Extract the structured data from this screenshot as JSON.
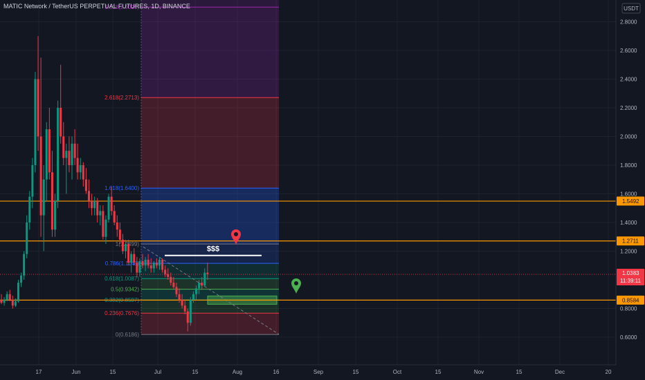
{
  "header": {
    "title": "MATIC Network / TetherUS PERPETUAL FUTURES, 1D, BINANCE",
    "currency_button": "USDT"
  },
  "price_axis": {
    "ticks": [
      "2.8000",
      "2.6000",
      "2.4000",
      "2.2000",
      "2.0000",
      "1.8000",
      "1.6000",
      "1.4000",
      "1.2000",
      "0.8000",
      "0.6000"
    ],
    "tick_values": [
      2.8,
      2.6,
      2.4,
      2.2,
      2.0,
      1.8,
      1.6,
      1.4,
      1.2,
      0.8,
      0.6
    ],
    "current_price": "1.0383",
    "countdown": "11:39:11",
    "level_labels": [
      {
        "text": "1.5492",
        "value": 1.5492
      },
      {
        "text": "1.2711",
        "value": 1.2711
      },
      {
        "text": "0.8584",
        "value": 0.8584
      }
    ]
  },
  "time_axis": {
    "labels": [
      "17",
      "Jun",
      "15",
      "Jul",
      "15",
      "Aug",
      "16",
      "Sep",
      "15",
      "Oct",
      "15",
      "Nov",
      "15",
      "Dec",
      "20"
    ]
  },
  "fib": {
    "levels": [
      {
        "label": "3.618(2.9026)",
        "value": 2.9026,
        "color": "#9c27b0"
      },
      {
        "label": "2.618(2.2713)",
        "value": 2.2713,
        "color": "#f23645"
      },
      {
        "label": "1.618(1.6400)",
        "value": 1.64,
        "color": "#2962ff"
      },
      {
        "label": "1(1.2499)",
        "value": 1.2499,
        "color": "#787b86"
      },
      {
        "label": "0.786(1.1148)",
        "value": 1.1148,
        "color": "#2962ff"
      },
      {
        "label": "0.618(1.0087)",
        "value": 1.0087,
        "color": "#089981"
      },
      {
        "label": "0.5(0.9342)",
        "value": 0.9342,
        "color": "#4caf50"
      },
      {
        "label": "0.382(0.8597)",
        "value": 0.8597,
        "color": "#089981"
      },
      {
        "label": "0.236(0.7676)",
        "value": 0.7676,
        "color": "#f23645"
      },
      {
        "label": "0(0.6186)",
        "value": 0.6186,
        "color": "#787b86"
      }
    ]
  },
  "annotations": {
    "liquidity_text": "$$$",
    "target_marker": "map-pin-red-icon",
    "entry_marker": "map-pin-green-icon"
  },
  "colors": {
    "background": "#131722",
    "up": "#089981",
    "down": "#f23645",
    "level_line": "#ff9800",
    "current_price_bg": "#f23645"
  },
  "chart_data": {
    "type": "candlestick",
    "title": "MATIC Network / TetherUS PERPETUAL FUTURES, 1D, BINANCE",
    "ylim": [
      0.55,
      2.95
    ],
    "horizontal_levels": [
      1.5492,
      1.2711,
      0.8584
    ],
    "current_price": 1.0383,
    "candles": [
      [
        0.86,
        0.9,
        0.83,
        0.84
      ],
      [
        0.84,
        0.88,
        0.82,
        0.86
      ],
      [
        0.86,
        0.92,
        0.85,
        0.9
      ],
      [
        0.9,
        0.93,
        0.85,
        0.86
      ],
      [
        0.86,
        0.89,
        0.8,
        0.82
      ],
      [
        0.82,
        0.87,
        0.81,
        0.85
      ],
      [
        0.85,
        1.0,
        0.84,
        0.98
      ],
      [
        0.98,
        1.05,
        0.95,
        1.03
      ],
      [
        1.03,
        1.2,
        1.0,
        1.18
      ],
      [
        1.18,
        1.45,
        1.15,
        1.4
      ],
      [
        1.4,
        1.62,
        1.35,
        1.58
      ],
      [
        1.58,
        1.85,
        1.5,
        1.8
      ],
      [
        1.8,
        2.45,
        1.75,
        2.4
      ],
      [
        2.4,
        2.7,
        1.9,
        2.0
      ],
      [
        2.0,
        2.55,
        1.3,
        1.45
      ],
      [
        1.45,
        1.8,
        1.2,
        1.7
      ],
      [
        1.7,
        2.1,
        1.55,
        2.05
      ],
      [
        2.05,
        2.2,
        1.7,
        1.75
      ],
      [
        1.75,
        1.9,
        1.3,
        1.35
      ],
      [
        1.35,
        1.6,
        1.3,
        1.55
      ],
      [
        1.55,
        2.25,
        1.5,
        2.2
      ],
      [
        2.2,
        2.5,
        1.95,
        2.0
      ],
      [
        2.0,
        2.1,
        1.8,
        1.85
      ],
      [
        1.85,
        1.95,
        1.6,
        1.9
      ],
      [
        1.9,
        2.0,
        1.75,
        1.8
      ],
      [
        1.8,
        2.0,
        1.7,
        1.95
      ],
      [
        1.95,
        2.05,
        1.8,
        1.85
      ],
      [
        1.85,
        1.95,
        1.7,
        1.75
      ],
      [
        1.75,
        1.85,
        1.7,
        1.8
      ],
      [
        1.8,
        1.82,
        1.65,
        1.7
      ],
      [
        1.7,
        1.78,
        1.6,
        1.62
      ],
      [
        1.62,
        1.7,
        1.5,
        1.55
      ],
      [
        1.55,
        1.6,
        1.45,
        1.5
      ],
      [
        1.5,
        1.58,
        1.45,
        1.55
      ],
      [
        1.55,
        1.57,
        1.4,
        1.45
      ],
      [
        1.45,
        1.52,
        1.38,
        1.48
      ],
      [
        1.48,
        1.52,
        1.28,
        1.3
      ],
      [
        1.3,
        1.45,
        1.25,
        1.42
      ],
      [
        1.42,
        1.6,
        1.4,
        1.58
      ],
      [
        1.58,
        1.65,
        1.45,
        1.48
      ],
      [
        1.48,
        1.52,
        1.38,
        1.4
      ],
      [
        1.4,
        1.45,
        1.3,
        1.35
      ],
      [
        1.35,
        1.4,
        1.25,
        1.28
      ],
      [
        1.28,
        1.32,
        1.18,
        1.2
      ],
      [
        1.2,
        1.28,
        1.15,
        1.25
      ],
      [
        1.25,
        1.28,
        1.1,
        1.12
      ],
      [
        1.12,
        1.2,
        1.05,
        1.18
      ],
      [
        1.18,
        1.22,
        1.1,
        1.12
      ],
      [
        1.12,
        1.16,
        1.02,
        1.05
      ],
      [
        1.05,
        1.15,
        1.02,
        1.13
      ],
      [
        1.13,
        1.18,
        1.08,
        1.1
      ],
      [
        1.1,
        1.16,
        1.06,
        1.14
      ],
      [
        1.14,
        1.18,
        1.08,
        1.1
      ],
      [
        1.1,
        1.15,
        1.05,
        1.08
      ],
      [
        1.08,
        1.13,
        1.05,
        1.12
      ],
      [
        1.12,
        1.15,
        1.08,
        1.1
      ],
      [
        1.1,
        1.16,
        1.07,
        1.14
      ],
      [
        1.14,
        1.15,
        1.05,
        1.07
      ],
      [
        1.07,
        1.1,
        1.02,
        1.04
      ],
      [
        1.04,
        1.08,
        1.0,
        1.02
      ],
      [
        1.02,
        1.05,
        0.96,
        0.98
      ],
      [
        0.98,
        1.02,
        0.94,
        0.95
      ],
      [
        0.95,
        0.98,
        0.88,
        0.9
      ],
      [
        0.9,
        0.94,
        0.84,
        0.86
      ],
      [
        0.86,
        0.9,
        0.8,
        0.82
      ],
      [
        0.82,
        0.86,
        0.76,
        0.78
      ],
      [
        0.78,
        0.8,
        0.64,
        0.7
      ],
      [
        0.7,
        0.88,
        0.68,
        0.86
      ],
      [
        0.86,
        0.92,
        0.84,
        0.9
      ],
      [
        0.9,
        0.96,
        0.86,
        0.94
      ],
      [
        0.94,
        1.0,
        0.9,
        0.98
      ],
      [
        0.98,
        1.02,
        0.93,
        0.96
      ],
      [
        0.96,
        1.08,
        0.95,
        1.05
      ],
      [
        1.05,
        1.12,
        1.0,
        1.04
      ]
    ]
  }
}
